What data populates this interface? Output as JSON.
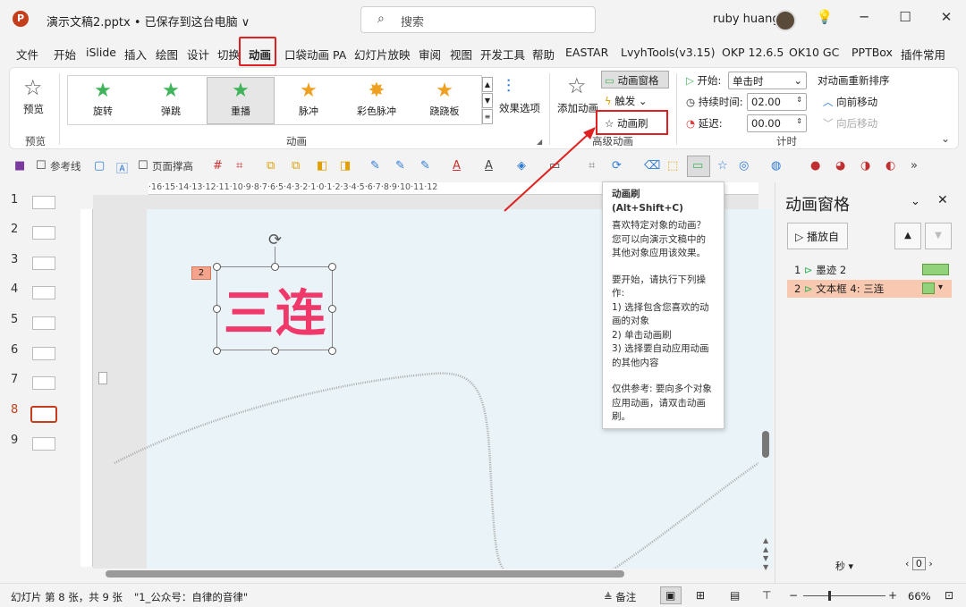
{
  "window": {
    "logo": "P",
    "title": "演示文稿2.pptx • 已保存到这台电脑 ∨",
    "search_placeholder": "搜索",
    "user_name": "ruby huang",
    "minimize": "─",
    "maximize": "☐",
    "close": "✕",
    "lightbulb": "♡"
  },
  "tabs": [
    "文件",
    "开始",
    "iSlide",
    "插入",
    "绘图",
    "设计",
    "切换",
    "动画",
    "口袋动画 PA",
    "幻灯片放映",
    "审阅",
    "视图",
    "开发工具",
    "帮助",
    "EASTAR",
    "LvyhTools(v3.15)",
    "OKP 12.6.5",
    "OK10 GC",
    "PPTBox",
    "插件常用"
  ],
  "ribbon": {
    "preview_label": "预览",
    "preview_group": "预览",
    "gallery": [
      {
        "label": "旋转",
        "color": "#3fb45a"
      },
      {
        "label": "弹跳",
        "color": "#3fb45a"
      },
      {
        "label": "重播",
        "color": "#3fb45a"
      },
      {
        "label": "脉冲",
        "color": "#f0a020"
      },
      {
        "label": "彩色脉冲",
        "color": "#f0a020"
      },
      {
        "label": "跷跷板",
        "color": "#f0a020"
      }
    ],
    "animation_group": "动画",
    "effect_options": "效果选项",
    "add_animation": "添加动画",
    "animation_pane": "动画窗格",
    "trigger": "触发",
    "animation_painter": "动画刷",
    "advanced_group": "高级动画",
    "start_label": "开始:",
    "start_value": "单击时",
    "duration_label": "持续时间:",
    "duration_value": "02.00",
    "delay_label": "延迟:",
    "delay_value": "00.00",
    "timing_group": "计时",
    "reorder_label": "对动画重新排序",
    "move_earlier": "向前移动",
    "move_later": "向后移动"
  },
  "qat": {
    "guides_label": "参考线",
    "fit_label": "页面撑高"
  },
  "thumbnails": [
    "1",
    "2",
    "3",
    "4",
    "5",
    "6",
    "7",
    "8",
    "9"
  ],
  "selected_slide": "8",
  "ruler_top": "·16·15·14·13·12·11·10·9·8·7·6·5·4·3·2·1·0·1·2·3·4·5·6·7·8·9·10·11·12",
  "slide": {
    "text": "三连",
    "anim_tag": "2"
  },
  "tooltip": {
    "title": "动画刷 (Alt+Shift+C)",
    "p1": "喜欢特定对象的动画？您可以向演示文稿中的其他对象应用该效果。",
    "p2": "要开始，请执行下列操作:\n1) 选择包含您喜欢的动画的对象\n2) 单击动画刷\n3) 选择要自动应用动画的其他内容",
    "p3": "仅供参考: 要向多个对象应用动画，请双击动画刷。"
  },
  "anim_pane": {
    "title": "动画窗格",
    "play_from": "播放自",
    "items": [
      {
        "num": "1",
        "label": "墨迹 2"
      },
      {
        "num": "2",
        "label": "文本框 4: 三连"
      }
    ],
    "seconds": "秒",
    "zoom_val": "0"
  },
  "status": {
    "slide_info": "幻灯片 第 8 张，共 9 张",
    "theme": "\"1_公众号：自律的音律\"",
    "notes": "备注",
    "zoom": "66%"
  }
}
